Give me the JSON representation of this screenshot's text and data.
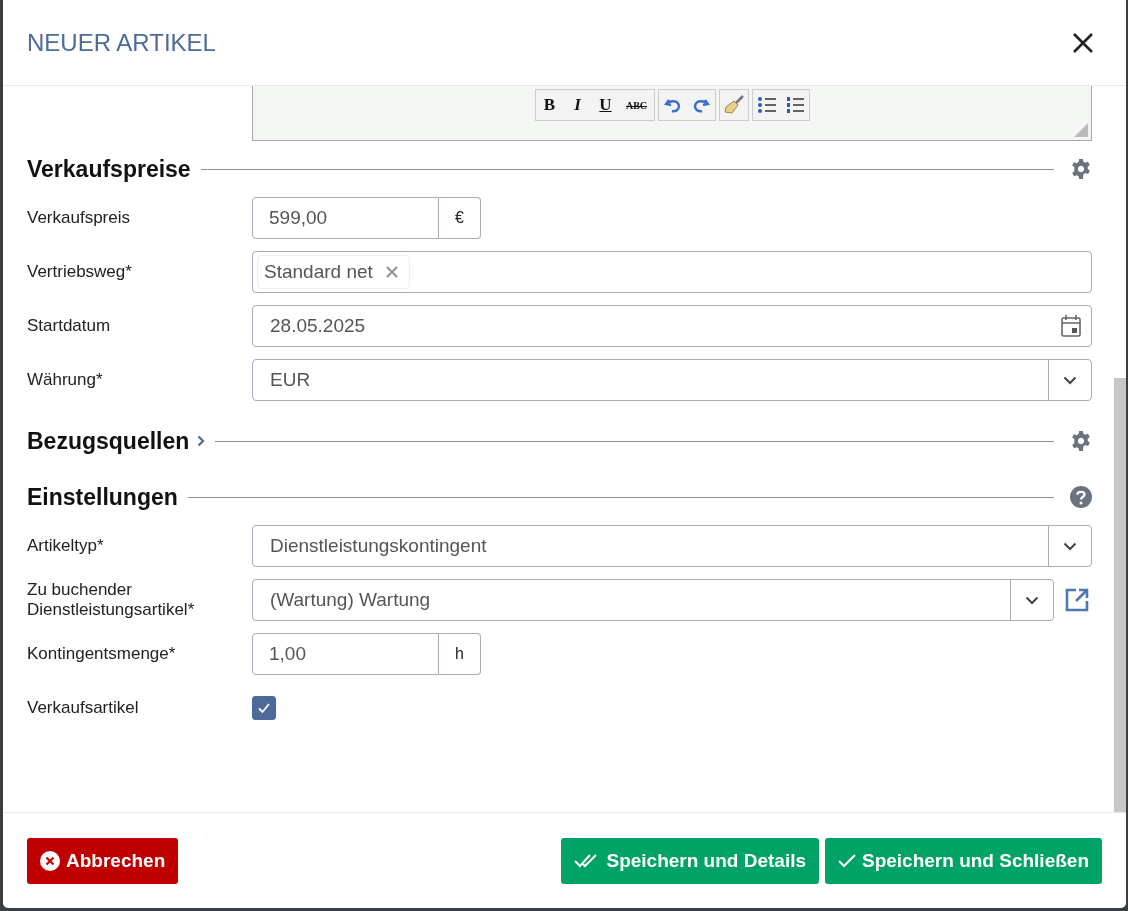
{
  "window": {
    "title": "NEUER ARTIKEL"
  },
  "editor_toolbar": [
    [
      {
        "kind": "bold",
        "label": "B"
      },
      {
        "kind": "italic",
        "label": "I"
      },
      {
        "kind": "underline",
        "label": "U"
      },
      {
        "kind": "strike",
        "label": "ABC"
      }
    ],
    [
      {
        "kind": "undo"
      },
      {
        "kind": "redo"
      }
    ],
    [
      {
        "kind": "clean"
      }
    ],
    [
      {
        "kind": "bullets"
      },
      {
        "kind": "numbers"
      }
    ]
  ],
  "sections": [
    {
      "title": "Verkaufspreise",
      "expanded": true,
      "kind": "settings",
      "fields": [
        {
          "kind": "addon",
          "label": "Verkaufspreis",
          "value": "599,00",
          "addon": "€"
        },
        {
          "kind": "tags",
          "label": "Vertriebsweg*",
          "tags": [
            "Standard net"
          ]
        },
        {
          "kind": "date",
          "label": "Startdatum",
          "value": "28.05.2025"
        },
        {
          "kind": "select",
          "label": "Währung*",
          "value": "EUR"
        }
      ]
    },
    {
      "title": "Bezugsquellen",
      "expanded": false,
      "kind": "settings"
    },
    {
      "title": "Einstellungen",
      "expanded": true,
      "kind": "help",
      "fields": [
        {
          "kind": "select",
          "label": "Artikeltyp*",
          "value": "Dienstleistungskontingent"
        },
        {
          "kind": "select-link",
          "label": "Zu buchender Dienstleistungsartikel*",
          "value": "(Wartung) Wartung"
        },
        {
          "kind": "addon",
          "label": "Kontingentsmenge*",
          "value": "1,00",
          "addon": "h"
        },
        {
          "kind": "checkbox",
          "label": "Verkaufsartikel",
          "checked": true
        }
      ]
    }
  ],
  "footer": {
    "cancel": "Abbrechen",
    "save_details": "Speichern und Details",
    "save_close": "Speichern und Schließen"
  }
}
